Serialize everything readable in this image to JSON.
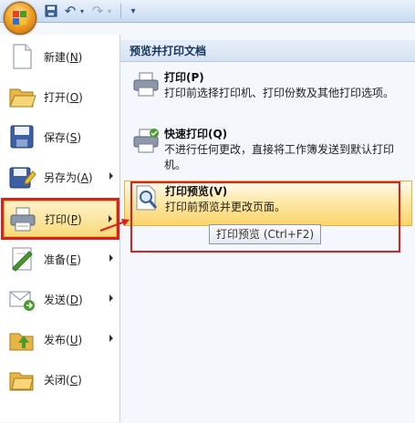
{
  "quick_access": {
    "undo_glyph": "↶",
    "redo_glyph": "↷",
    "customize_glyph": "▾"
  },
  "right_panel": {
    "header": "预览并打印文档",
    "items": [
      {
        "title": "打印(P)",
        "desc": "打印前选择打印机、打印份数及其他打印选项。",
        "icon": "printer-icon"
      },
      {
        "title": "快速打印(Q)",
        "desc": "不进行任何更改，直接将工作簿发送到默认打印机。",
        "icon": "quick-print-icon"
      },
      {
        "title": "打印预览(V)",
        "desc": "打印前预览并更改页面。",
        "icon": "print-preview-icon"
      }
    ]
  },
  "left_menu": {
    "items": [
      {
        "pre": "新建(",
        "key": "N",
        "post": ")",
        "icon": "new-document-icon",
        "submenu": false
      },
      {
        "pre": "打开(",
        "key": "O",
        "post": ")",
        "icon": "open-folder-icon",
        "submenu": false
      },
      {
        "pre": "保存(",
        "key": "S",
        "post": ")",
        "icon": "save-disk-icon",
        "submenu": false
      },
      {
        "pre": "另存为(",
        "key": "A",
        "post": ")",
        "icon": "save-as-icon",
        "submenu": true
      },
      {
        "pre": "打印(",
        "key": "P",
        "post": ")",
        "icon": "print-icon",
        "submenu": true
      },
      {
        "pre": "准备(",
        "key": "E",
        "post": ")",
        "icon": "prepare-icon",
        "submenu": true
      },
      {
        "pre": "发送(",
        "key": "D",
        "post": ")",
        "icon": "send-icon",
        "submenu": true
      },
      {
        "pre": "发布(",
        "key": "U",
        "post": ")",
        "icon": "publish-icon",
        "submenu": true
      },
      {
        "pre": "关闭(",
        "key": "C",
        "post": ")",
        "icon": "close-folder-icon",
        "submenu": false
      }
    ]
  },
  "tooltip": "打印预览 (Ctrl+F2)",
  "colors": {
    "highlight": "#fbd46a",
    "annotation_red": "#d9221f",
    "header_text": "#15335c"
  }
}
